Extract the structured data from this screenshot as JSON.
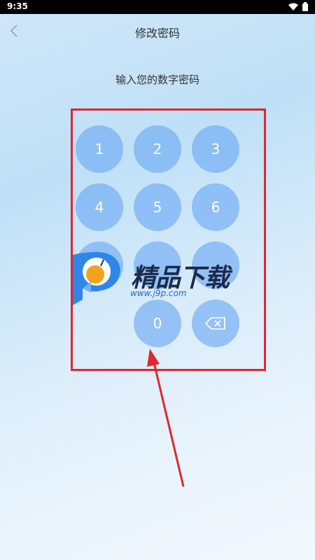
{
  "status": {
    "time": "9:35"
  },
  "header": {
    "title": "修改密码"
  },
  "prompt": "输入您的数字密码",
  "keypad": {
    "keys": [
      "1",
      "2",
      "3",
      "4",
      "5",
      "6",
      "0"
    ]
  },
  "watermark": {
    "brand": "精品下载",
    "url": "www.j9p.com"
  },
  "colors": {
    "key_fill": "#6eaaf5",
    "highlight": "#e0262f",
    "arrow": "#e0262f"
  }
}
